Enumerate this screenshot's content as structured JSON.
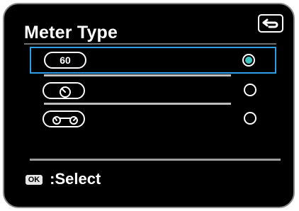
{
  "header": {
    "title": "Meter Type",
    "back_icon": "back-return-icon"
  },
  "menu": {
    "items": [
      {
        "label": "60",
        "icon": "meter-numeric-icon",
        "selected": true
      },
      {
        "label": "",
        "icon": "meter-analog-gauge-icon",
        "selected": false
      },
      {
        "label": "",
        "icon": "meter-dual-gauge-icon",
        "selected": false
      }
    ]
  },
  "footer": {
    "ok_label": "OK",
    "action_label": ":Select"
  },
  "colors": {
    "selection_outline": "#2e9fe6",
    "radio_selected": "#3fc4c4",
    "background": "#000000",
    "text": "#ffffff"
  }
}
